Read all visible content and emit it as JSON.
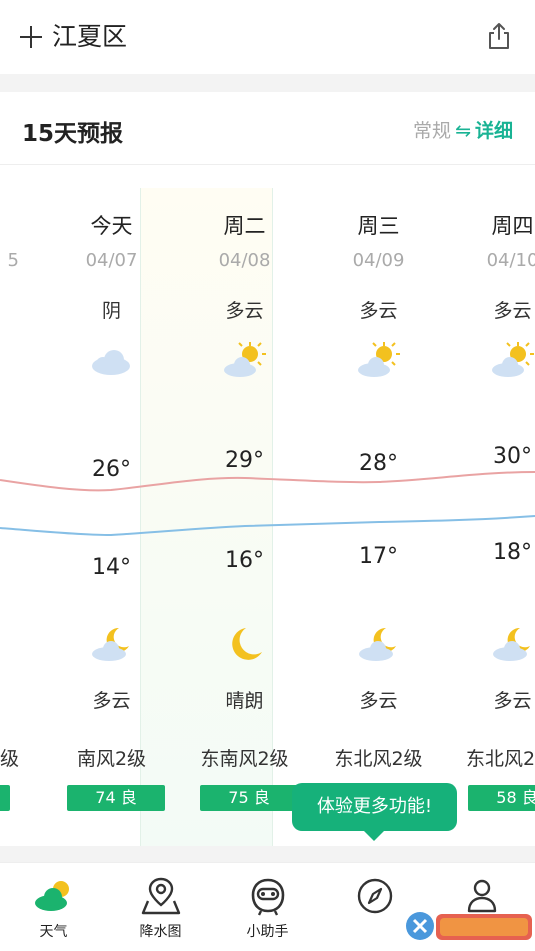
{
  "header": {
    "city": "江夏区"
  },
  "card": {
    "title": "15天预报",
    "mode_normal": "常规",
    "mode_swap": "⇋",
    "mode_detail": "详细"
  },
  "days": [
    {
      "day": "",
      "date": "5",
      "cond": "",
      "hi": "",
      "lo": "",
      "ncond": "",
      "wind": "级",
      "aqi": ""
    },
    {
      "day": "今天",
      "date": "04/07",
      "cond": "阴",
      "hi": "26°",
      "lo": "14°",
      "ncond": "多云",
      "wind": "南风2级",
      "aqi": "74 良",
      "day_icon": "cloud-icon",
      "night_icon": "moon-cloud-icon"
    },
    {
      "day": "周二",
      "date": "04/08",
      "cond": "多云",
      "hi": "29°",
      "lo": "16°",
      "ncond": "晴朗",
      "wind": "东南风2级",
      "aqi": "75 良",
      "day_icon": "sun-cloud-icon",
      "night_icon": "moon-icon"
    },
    {
      "day": "周三",
      "date": "04/09",
      "cond": "多云",
      "hi": "28°",
      "lo": "17°",
      "ncond": "多云",
      "wind": "东北风2级",
      "aqi": "",
      "day_icon": "sun-cloud-icon",
      "night_icon": "moon-cloud-icon"
    },
    {
      "day": "周四",
      "date": "04/10",
      "cond": "多云",
      "hi": "30°",
      "lo": "18°",
      "ncond": "多云",
      "wind": "东北风2",
      "aqi": "58 良",
      "day_icon": "sun-cloud-icon",
      "night_icon": "moon-cloud-icon"
    }
  ],
  "tooltip": "体验更多功能!",
  "nav": [
    {
      "label": "天气",
      "icon": "weather-icon"
    },
    {
      "label": "降水图",
      "icon": "map-pin-icon"
    },
    {
      "label": "小助手",
      "icon": "assistant-icon"
    },
    {
      "label": "",
      "icon": "compass-icon"
    },
    {
      "label": "",
      "icon": "profile-icon"
    }
  ],
  "colors": {
    "accent": "#19b394",
    "aqi": "#1bb36e",
    "high_line": "#e9a3a3",
    "low_line": "#86bfe6"
  }
}
